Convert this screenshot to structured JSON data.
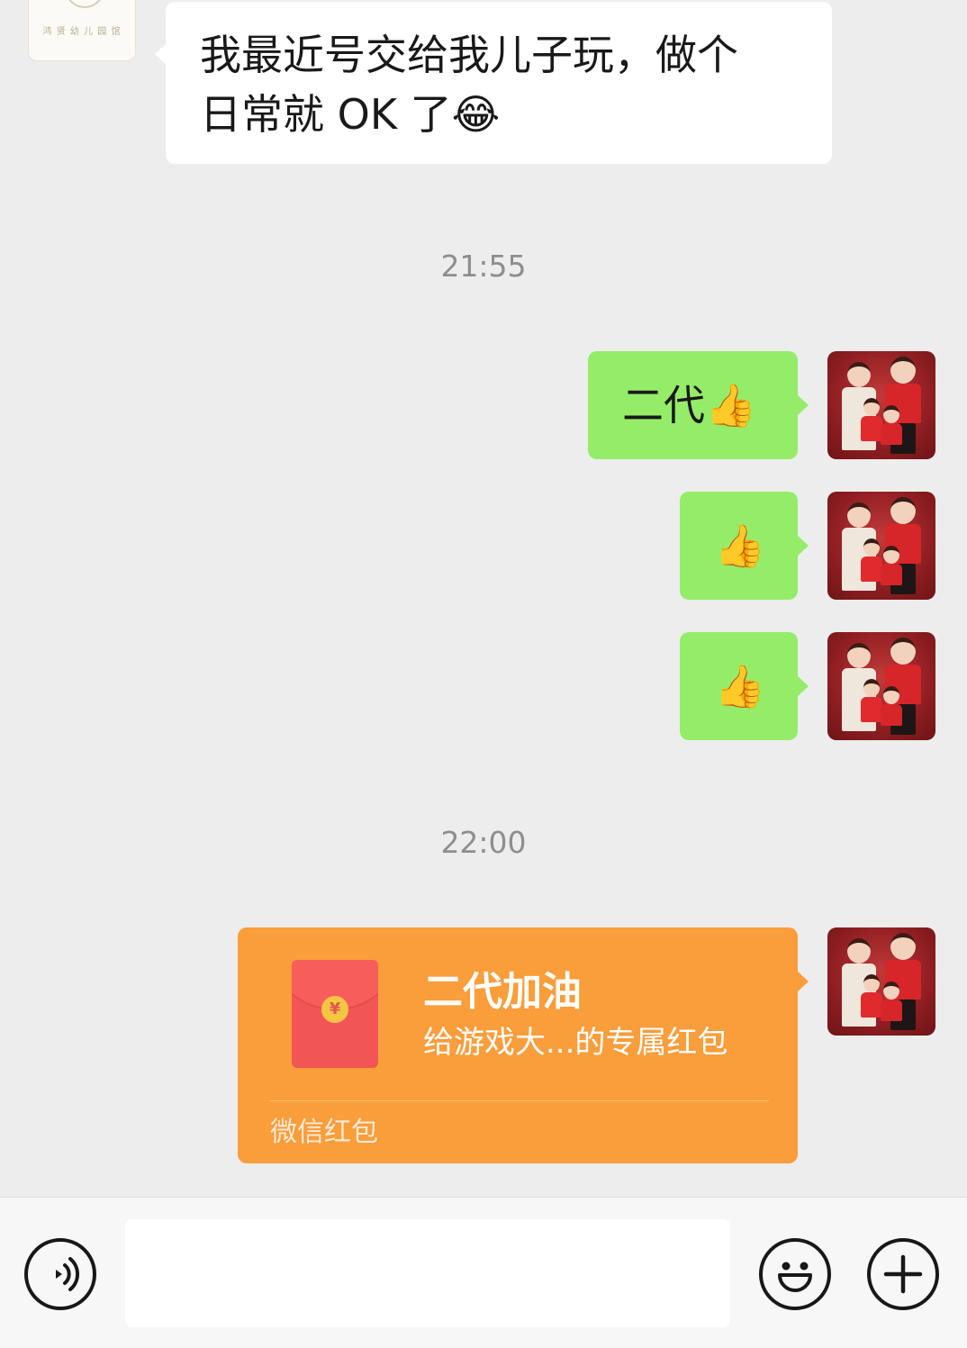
{
  "messages": {
    "incoming_1": {
      "line1": "我最近号交给我儿子玩，做个",
      "line2": "日常就 OK 了",
      "emoji": "😂"
    },
    "time_1": "21:55",
    "outgoing_1": {
      "text": "二代",
      "emoji": "👍"
    },
    "outgoing_2": {
      "emoji": "👍"
    },
    "outgoing_3": {
      "emoji": "👍"
    },
    "time_2": "22:00",
    "red_packet": {
      "title": "二代加油",
      "subtitle": "给游戏大...的专属红包",
      "footer": "微信红包",
      "coin_symbol": "¥"
    }
  },
  "input_bar": {
    "voice_icon": "voice-icon",
    "emoji_icon": "smiley-icon",
    "more_icon": "plus-icon",
    "text_value": ""
  },
  "colors": {
    "chat_background": "#ededed",
    "self_bubble": "#95ec69",
    "other_bubble": "#ffffff",
    "red_packet": "#fa9d3b",
    "timestamp": "#8e8e8e"
  }
}
